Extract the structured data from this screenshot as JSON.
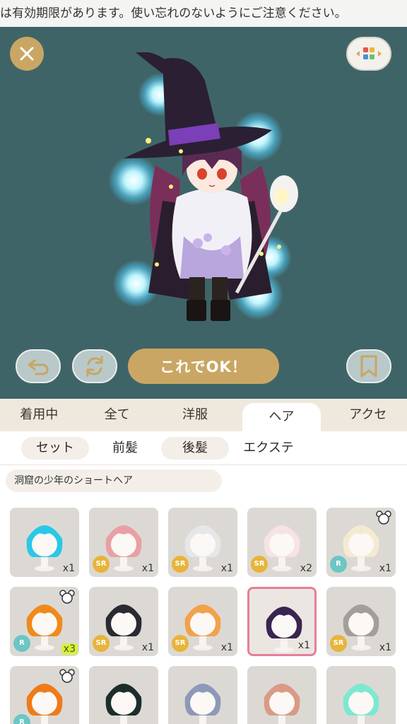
{
  "notice": "は有効期限があります。使い忘れのないようにご注意ください。",
  "stage": {
    "ok_label": "これでOK！",
    "background": "#3f6468",
    "gold": "#c9a663"
  },
  "tabs": [
    {
      "label": "着用中"
    },
    {
      "label": "全て"
    },
    {
      "label": "洋服"
    },
    {
      "label": "ヘア",
      "active": true
    },
    {
      "label": "アクセ"
    }
  ],
  "subtabs": [
    {
      "label": "セット"
    },
    {
      "label": "前髪",
      "active": true
    },
    {
      "label": "後髪"
    },
    {
      "label": "エクステ"
    }
  ],
  "selected_item_name": "洞窟の少年のショートヘア",
  "items": [
    {
      "hair": "#29c8e8",
      "rarity": "",
      "count": "x1",
      "bear": false
    },
    {
      "hair": "#e9a0a4",
      "rarity": "SR",
      "count": "x1",
      "bear": false
    },
    {
      "hair": "#e7e6e8",
      "rarity": "SR",
      "count": "x1",
      "bear": false
    },
    {
      "hair": "#f7e2e4",
      "rarity": "SR",
      "count": "x2",
      "bear": false
    },
    {
      "hair": "#f3ead0",
      "rarity": "R",
      "count": "x1",
      "bear": true
    },
    {
      "hair": "#f08a1a",
      "rarity": "R",
      "count": "x3",
      "bear": true
    },
    {
      "hair": "#2a2a33",
      "rarity": "SR",
      "count": "x1",
      "bear": false
    },
    {
      "hair": "#f1a24a",
      "rarity": "SR",
      "count": "x1",
      "bear": false
    },
    {
      "hair": "#3a2450",
      "rarity": "",
      "count": "x1",
      "bear": false,
      "selected": true
    },
    {
      "hair": "#a49e9a",
      "rarity": "SR",
      "count": "x1",
      "bear": false
    },
    {
      "hair": "#f07a18",
      "rarity": "R",
      "count": "",
      "bear": true
    },
    {
      "hair": "#1c2e2c",
      "rarity": "",
      "count": "",
      "bear": false
    },
    {
      "hair": "#8e98b8",
      "rarity": "",
      "count": "",
      "bear": false
    },
    {
      "hair": "#d99a86",
      "rarity": "",
      "count": "",
      "bear": false
    },
    {
      "hair": "#7de8d0",
      "rarity": "",
      "count": "",
      "bear": false
    }
  ]
}
